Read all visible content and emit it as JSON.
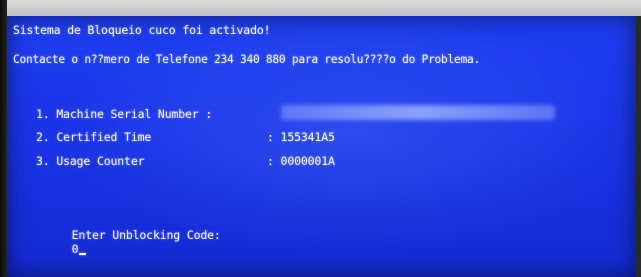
{
  "screen": {
    "header_line_1": "Sistema de Bloqueio cuco foi activado!",
    "header_line_2": "Contacte o n??mero de Telefone 234 340 880 para resolu????o do Problema.",
    "fields": [
      {
        "label": "1. Machine Serial Number :",
        "value": ""
      },
      {
        "label": "2. Certified Time",
        "value": ": 155341A5"
      },
      {
        "label": "3. Usage Counter",
        "value": ": 0000001A"
      }
    ],
    "prompt_label": "Enter Unblocking Code:",
    "prompt_value": "0"
  },
  "colors": {
    "screen_background": "#1a33e6",
    "text": "#f2f4ff"
  }
}
